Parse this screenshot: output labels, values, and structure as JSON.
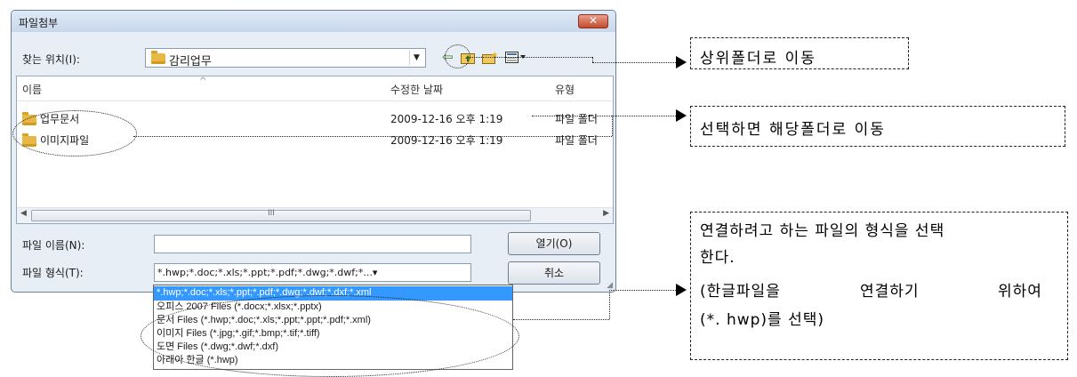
{
  "dialog": {
    "title": "파일첨부",
    "close_label": "✕",
    "look_in_label": "찾는 위치(I):",
    "look_in_value": "감리업무",
    "toolbar": {
      "back_icon": "⇦",
      "up_icon": "up-folder-icon",
      "new_folder_icon": "new-folder-icon",
      "view_icon": "view-menu-icon"
    }
  },
  "filelist": {
    "columns": [
      "이름",
      "수정한 날짜",
      "유형"
    ],
    "rows": [
      {
        "name": "업무문서",
        "date": "2009-12-16 오후 1:19",
        "type": "파일 폴더"
      },
      {
        "name": "이미지파일",
        "date": "2009-12-16 오후 1:19",
        "type": "파일 폴더"
      }
    ],
    "scroll_thumb_glyph": "III"
  },
  "form": {
    "filename_label": "파일 이름(N):",
    "filename_value": "",
    "filetype_label": "파일 형식(T):",
    "filetype_value": "*.hwp;*.doc;*.xls;*.ppt;*.pdf;*.dwg;*.dwf;*...▾",
    "open_button": "열기(O)",
    "cancel_button": "취소"
  },
  "filetype_options": [
    "*.hwp;*.doc;*.xls;*.ppt;*.pdf;*.dwg;*.dwf;*.dxf;*.xml",
    "오피스 2007 Files (*.docx;*.xlsx;*.pptx)",
    "문서 Files (*.hwp;*.doc;*.xls;*.ppt;*.ppt;*.pdf;*.xml)",
    "이미지 Files (*.jpg;*.gif;*.bmp;*.tif;*.tiff)",
    "도면 Files (*.dwg;*.dwf;*.dxf)",
    "아래아 한글 (*.hwp)"
  ],
  "annotations": {
    "up_folder": "상위폴더로 이동",
    "select_folder": "선택하면 해당폴더로 이동",
    "filetype_line1": "연결하려고 하는 파일의 형식을 선택",
    "filetype_line2": "한다.",
    "filetype_line3a": "(한글파일을",
    "filetype_line3b": "연결하기",
    "filetype_line3c": "위하여",
    "filetype_line4": "(*. hwp)를 선택)"
  },
  "colors": {
    "selection": "#3399ff",
    "close_button": "#c44a2c",
    "folder": "#e8b847"
  }
}
